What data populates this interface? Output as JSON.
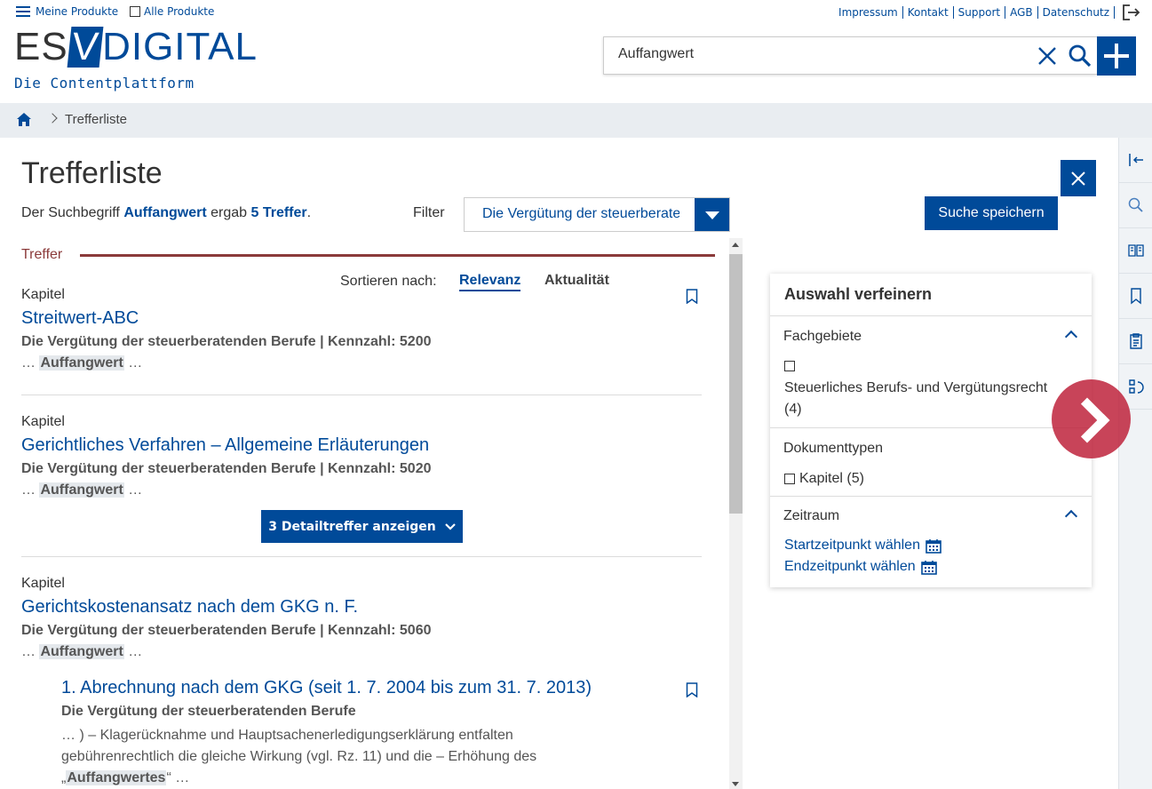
{
  "header": {
    "meine_produkte": "Meine Produkte",
    "alle_produkte": "Alle Produkte",
    "links": [
      "Impressum",
      "Kontakt",
      "Support",
      "AGB",
      "Datenschutz"
    ],
    "logo_esv": "ES",
    "logo_v": "V",
    "logo_digital": "DIGITAL",
    "logo_sub": "Die Contentplattform",
    "search_value": "Auffangwert"
  },
  "breadcrumb": {
    "current": "Trefferliste"
  },
  "page": {
    "title": "Trefferliste",
    "count_prefix": "Der Suchbegriff",
    "count_term": "Auffangwert",
    "count_mid": "ergab",
    "count_hits": "5 Treffer",
    "count_end": ".",
    "filter_label": "Filter",
    "filter_value": "Die Vergütung der steuerberatenden Berufe",
    "save_search": "Suche speichern"
  },
  "results_header": {
    "label": "Treffer",
    "sort_label": "Sortieren nach:",
    "sort_relevanz": "Relevanz",
    "sort_aktualitaet": "Aktualität"
  },
  "results": [
    {
      "type": "Kapitel",
      "title": "Streitwert-ABC",
      "meta": "Die Vergütung der steuerberatenden Berufe | Kennzahl: 5200",
      "snip_pre": "…",
      "snip_hl": "Auffangwert",
      "snip_post": "…"
    },
    {
      "type": "Kapitel",
      "title": "Gerichtliches Verfahren – Allgemeine Erläuterungen",
      "meta": "Die Vergütung der steuerberatenden Berufe | Kennzahl: 5020",
      "snip_pre": "…",
      "snip_hl": "Auffangwert",
      "snip_post": "…",
      "detail_btn": "3 Detailtreffer anzeigen"
    },
    {
      "type": "Kapitel",
      "title": "Gerichtskostenansatz nach dem GKG n. F.",
      "meta": "Die Vergütung der steuerberatenden Berufe | Kennzahl: 5060",
      "snip_pre": "…",
      "snip_hl": "Auffangwert",
      "snip_post": "…"
    }
  ],
  "sub_result": {
    "title": "1. Abrechnung nach dem GKG (seit 1. 7. 2004 bis zum 31. 7. 2013)",
    "meta": "Die Vergütung der steuerberatenden Berufe",
    "snip_1": "… ) – Klagerücknahme und Hauptsachenerledigungserklärung entfalten",
    "snip_2": "gebührenrechtlich die gleiche Wirkung (vgl. Rz. 11) und die – Erhöhung des",
    "snip_3_pre": "„",
    "snip_3_hl": "Auffangwertes",
    "snip_3_post": "“ …"
  },
  "refine": {
    "title": "Auswahl verfeinern",
    "fachgebiete": "Fachgebiete",
    "fach_opt_1": "Steuerliches Berufs- und Vergütungsrecht",
    "fach_opt_2": "(4)",
    "dokumenttypen": "Dokumenttypen",
    "dok_opt": "Kapitel (5)",
    "zeitraum": "Zeitraum",
    "start": "Startzeitpunkt wählen",
    "end": "Endzeitpunkt wählen"
  },
  "colors": {
    "brand": "#004a99",
    "accent": "#8b3a3a",
    "next": "#be233c"
  }
}
